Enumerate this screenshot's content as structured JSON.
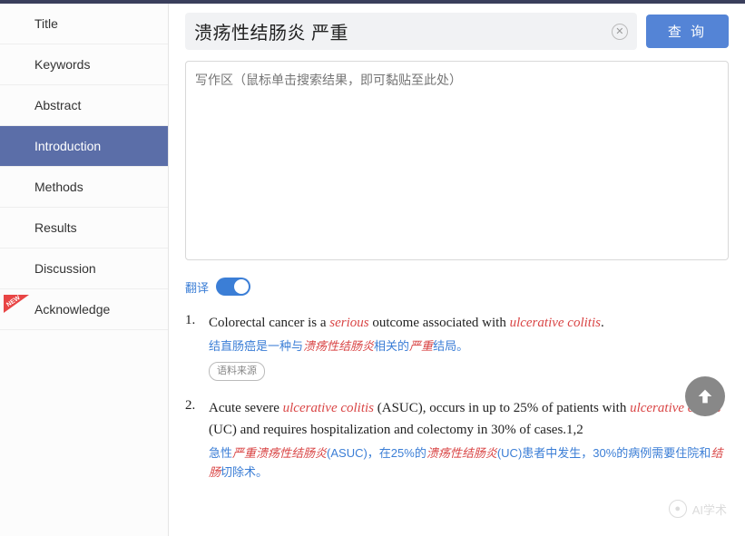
{
  "sidebar": {
    "items": [
      {
        "label": "Title"
      },
      {
        "label": "Keywords"
      },
      {
        "label": "Abstract"
      },
      {
        "label": "Introduction"
      },
      {
        "label": "Methods"
      },
      {
        "label": "Results"
      },
      {
        "label": "Discussion"
      },
      {
        "label": "Acknowledge"
      }
    ],
    "new_badge": "NEW"
  },
  "search": {
    "value": "溃疡性结肠炎 严重",
    "query_label": "查 询"
  },
  "write_area": {
    "placeholder": "写作区（鼠标单击搜索结果，即可黏贴至此处）"
  },
  "translate": {
    "label": "翻译"
  },
  "results": [
    {
      "num": "1.",
      "en_parts": [
        "Colorectal cancer is a ",
        "serious",
        " outcome associated with ",
        "ulcerative colitis",
        "."
      ],
      "zh_parts": [
        "结直肠癌是一种与",
        "溃疡性结肠炎",
        "相关的",
        "严重",
        "结局。"
      ],
      "source": "语料来源"
    },
    {
      "num": "2.",
      "en_parts": [
        "Acute severe ",
        "ulcerative colitis",
        " (ASUC), occurs in up to 25% of patients with ",
        "ulcerative colitis",
        " (UC) and requires hospitalization and colectomy in 30% of cases.1,2"
      ],
      "zh_parts": [
        "急性",
        "严重溃疡性结肠炎",
        "(ASUC)，在25%的",
        "溃疡性结肠炎",
        "(UC)患者中发生，30%的病例需要住院和",
        "结肠",
        "切除术。"
      ]
    }
  ],
  "watermark": "AI学术"
}
